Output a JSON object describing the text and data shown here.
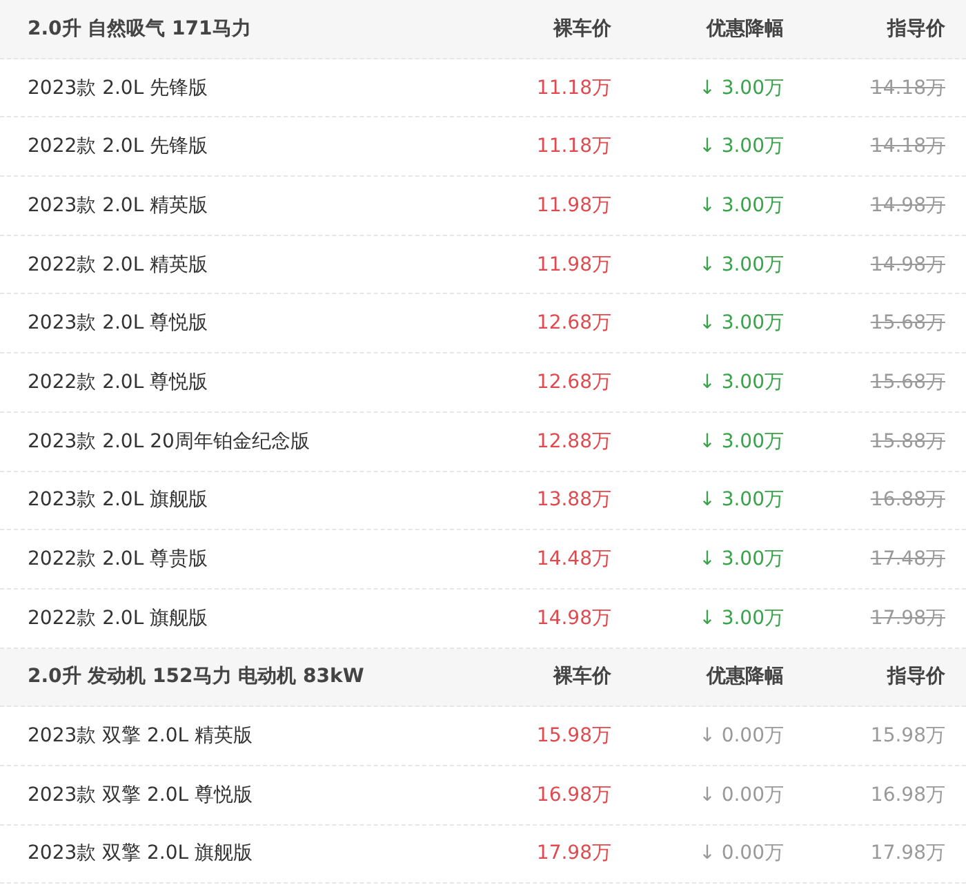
{
  "groups": [
    {
      "title": "2.0升 自然吸气 171马力",
      "columns": [
        "裸车价",
        "优惠降幅",
        "指导价"
      ],
      "rows": [
        {
          "name": "2023款 2.0L 先锋版",
          "price": "11.18万",
          "discount": "↓ 3.00万",
          "discounted": true,
          "guide": "14.18万"
        },
        {
          "name": "2022款 2.0L 先锋版",
          "price": "11.18万",
          "discount": "↓ 3.00万",
          "discounted": true,
          "guide": "14.18万"
        },
        {
          "name": "2023款 2.0L 精英版",
          "price": "11.98万",
          "discount": "↓ 3.00万",
          "discounted": true,
          "guide": "14.98万"
        },
        {
          "name": "2022款 2.0L 精英版",
          "price": "11.98万",
          "discount": "↓ 3.00万",
          "discounted": true,
          "guide": "14.98万"
        },
        {
          "name": "2023款 2.0L 尊悦版",
          "price": "12.68万",
          "discount": "↓ 3.00万",
          "discounted": true,
          "guide": "15.68万"
        },
        {
          "name": "2022款 2.0L 尊悦版",
          "price": "12.68万",
          "discount": "↓ 3.00万",
          "discounted": true,
          "guide": "15.68万"
        },
        {
          "name": "2023款 2.0L 20周年铂金纪念版",
          "price": "12.88万",
          "discount": "↓ 3.00万",
          "discounted": true,
          "guide": "15.88万"
        },
        {
          "name": "2023款 2.0L 旗舰版",
          "price": "13.88万",
          "discount": "↓ 3.00万",
          "discounted": true,
          "guide": "16.88万"
        },
        {
          "name": "2022款 2.0L 尊贵版",
          "price": "14.48万",
          "discount": "↓ 3.00万",
          "discounted": true,
          "guide": "17.48万"
        },
        {
          "name": "2022款 2.0L 旗舰版",
          "price": "14.98万",
          "discount": "↓ 3.00万",
          "discounted": true,
          "guide": "17.98万"
        }
      ]
    },
    {
      "title": "2.0升 发动机 152马力 电动机 83kW",
      "columns": [
        "裸车价",
        "优惠降幅",
        "指导价"
      ],
      "rows": [
        {
          "name": "2023款 双擎 2.0L 精英版",
          "price": "15.98万",
          "discount": "↓ 0.00万",
          "discounted": false,
          "guide": "15.98万"
        },
        {
          "name": "2023款 双擎 2.0L 尊悦版",
          "price": "16.98万",
          "discount": "↓ 0.00万",
          "discounted": false,
          "guide": "16.98万"
        },
        {
          "name": "2023款 双擎 2.0L 旗舰版",
          "price": "17.98万",
          "discount": "↓ 0.00万",
          "discounted": false,
          "guide": "17.98万"
        }
      ]
    }
  ]
}
